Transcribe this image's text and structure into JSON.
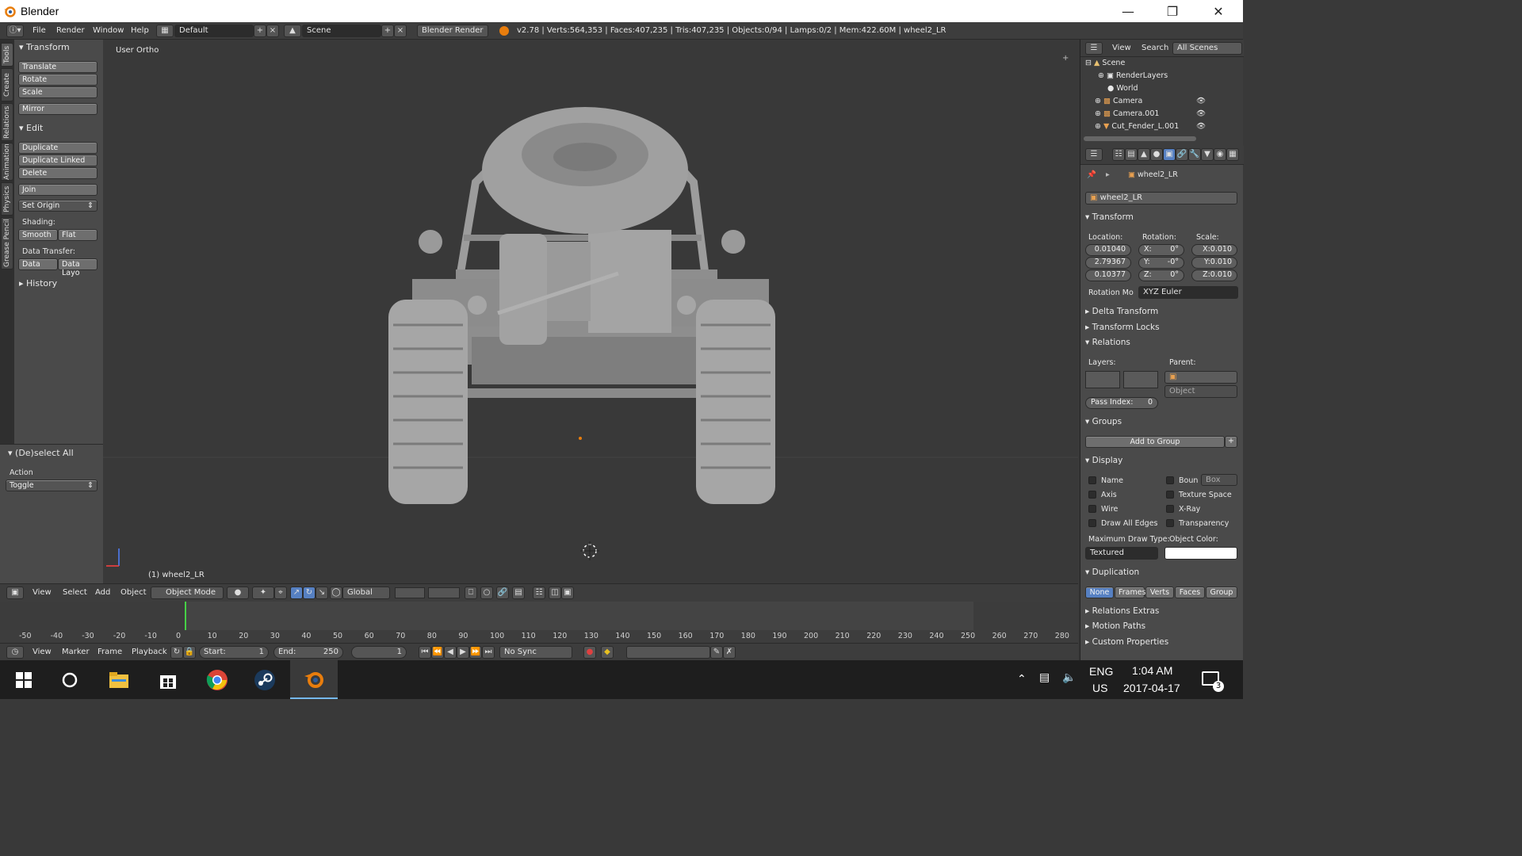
{
  "window": {
    "app_title": "Blender"
  },
  "info_header": {
    "menus": [
      "File",
      "Render",
      "Window",
      "Help"
    ],
    "screen_layout": "Default",
    "scene": "Scene",
    "render_engine": "Blender Render",
    "stats": "v2.78 | Verts:564,353 | Faces:407,235 | Tris:407,235 | Objects:0/94 | Lamps:0/2 | Mem:422.60M | wheel2_LR"
  },
  "shelf_tabs": [
    "Tools",
    "Create",
    "Relations",
    "Animation",
    "Physics",
    "Grease Pencil"
  ],
  "toolshelf": {
    "transform_title": "Transform",
    "translate": "Translate",
    "rotate": "Rotate",
    "scale": "Scale",
    "mirror": "Mirror",
    "edit_title": "Edit",
    "duplicate": "Duplicate",
    "duplicate_linked": "Duplicate Linked",
    "delete": "Delete",
    "join": "Join",
    "set_origin": "Set Origin",
    "shading_label": "Shading:",
    "smooth": "Smooth",
    "flat": "Flat",
    "data_transfer_label": "Data Transfer:",
    "data": "Data",
    "data_layo": "Data Layo",
    "history_title": "History"
  },
  "operator_panel": {
    "title": "(De)select All",
    "action_label": "Action",
    "action_value": "Toggle"
  },
  "viewport": {
    "view_label": "User Ortho",
    "object_label": "(1) wheel2_LR"
  },
  "view3d_header": {
    "menus": [
      "View",
      "Select",
      "Add",
      "Object"
    ],
    "mode": "Object Mode",
    "orientation": "Global"
  },
  "timeline": {
    "ruler_labels": [
      "-50",
      "-40",
      "-30",
      "-20",
      "-10",
      "0",
      "10",
      "20",
      "30",
      "40",
      "50",
      "60",
      "70",
      "80",
      "90",
      "100",
      "110",
      "120",
      "130",
      "140",
      "150",
      "160",
      "170",
      "180",
      "190",
      "200",
      "210",
      "220",
      "230",
      "240",
      "250",
      "260",
      "270",
      "280"
    ],
    "menus": [
      "View",
      "Marker",
      "Frame",
      "Playback"
    ],
    "start_label": "Start:",
    "start_value": "1",
    "end_label": "End:",
    "end_value": "250",
    "current_frame": "1",
    "sync": "No Sync"
  },
  "outliner": {
    "menus": [
      "View",
      "Search"
    ],
    "display_mode": "All Scenes",
    "items": [
      "Scene",
      "RenderLayers",
      "World",
      "Camera",
      "Camera.001",
      "Cut_Fender_L.001"
    ]
  },
  "properties": {
    "breadcrumb_object": "wheel2_LR",
    "object_name": "wheel2_LR",
    "transform_title": "Transform",
    "location_label": "Location:",
    "rotation_label": "Rotation:",
    "scale_label": "Scale:",
    "location": [
      "0.01040",
      "2.79367",
      "0.10377"
    ],
    "rotation": [
      "X:",
      "0°",
      "Y:",
      "-0°",
      "Z:",
      "0°"
    ],
    "scale": [
      "X:0.010",
      "Y:0.010",
      "Z:0.010"
    ],
    "rotation_mode_label": "Rotation Mo",
    "rotation_mode": "XYZ Euler",
    "delta_transform": "Delta Transform",
    "transform_locks": "Transform Locks",
    "relations": "Relations",
    "layers_label": "Layers:",
    "parent_label": "Parent:",
    "parent_type": "Object",
    "pass_index_label": "Pass Index:",
    "pass_index": "0",
    "groups": "Groups",
    "add_to_group": "Add to Group",
    "display": "Display",
    "display_opts": [
      "Name",
      "Axis",
      "Wire",
      "Draw All Edges"
    ],
    "display_opts_right": [
      "Boun",
      "Texture Space",
      "X-Ray",
      "Transparency"
    ],
    "bounds_type": "Box",
    "max_draw_type_label": "Maximum Draw Type:",
    "object_color_label": "Object Color:",
    "max_draw_type": "Textured",
    "duplication": "Duplication",
    "dup_opts": [
      "None",
      "Frames",
      "Verts",
      "Faces",
      "Group"
    ],
    "relations_extras": "Relations Extras",
    "motion_paths": "Motion Paths",
    "custom_properties": "Custom Properties"
  },
  "taskbar": {
    "lang": "ENG",
    "region": "US",
    "time": "1:04 AM",
    "date": "2017-04-17",
    "notifications": "3"
  },
  "colors": {
    "accent_blue": "#5680c2",
    "blender_orange": "#e87d0d",
    "active_frame": "#46d046"
  }
}
